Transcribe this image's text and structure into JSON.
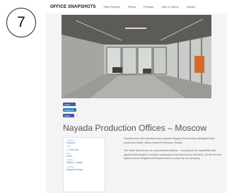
{
  "step_number": "7",
  "site": {
    "logo": "OFFICE SNAPSHOTS",
    "nav": [
      "Office Projects",
      "Photos",
      "Products",
      "Jobs & Careers",
      "Articles"
    ]
  },
  "share": {
    "tweet": "Tweet",
    "facebook": "Facebook",
    "linkedin": "Share",
    "linkedin_count": "1"
  },
  "title": "Nayada Production Offices – Moscow",
  "info": [
    {
      "label": "Location",
      "value": "Moscow"
    },
    {
      "label": "Size",
      "value": "17,000 sqft"
    },
    {
      "label": "Year",
      "value": "2015"
    },
    {
      "label": "Industry",
      "value": "Offices, Design"
    },
    {
      "label": "Architect",
      "value": "Nayada Design"
    }
  ],
  "description": [
    "Furniture and wall manufacturing company Nayada has recently redesigned their production facility offices located in Moscow, Russia.",
    "The office has become an experimental platform – showing all the capabilities and applied technologies of modern workspaces manufactured by NAYADA. All the internal systems were designed and implemented in-house by our company."
  ],
  "colors": {
    "accent_link": "#3a7fc1",
    "facebook_blue": "#3b5ea5",
    "twitter_blue": "#2c7fc0",
    "title_gray": "#555555",
    "page_background": "#f4f4f4"
  }
}
